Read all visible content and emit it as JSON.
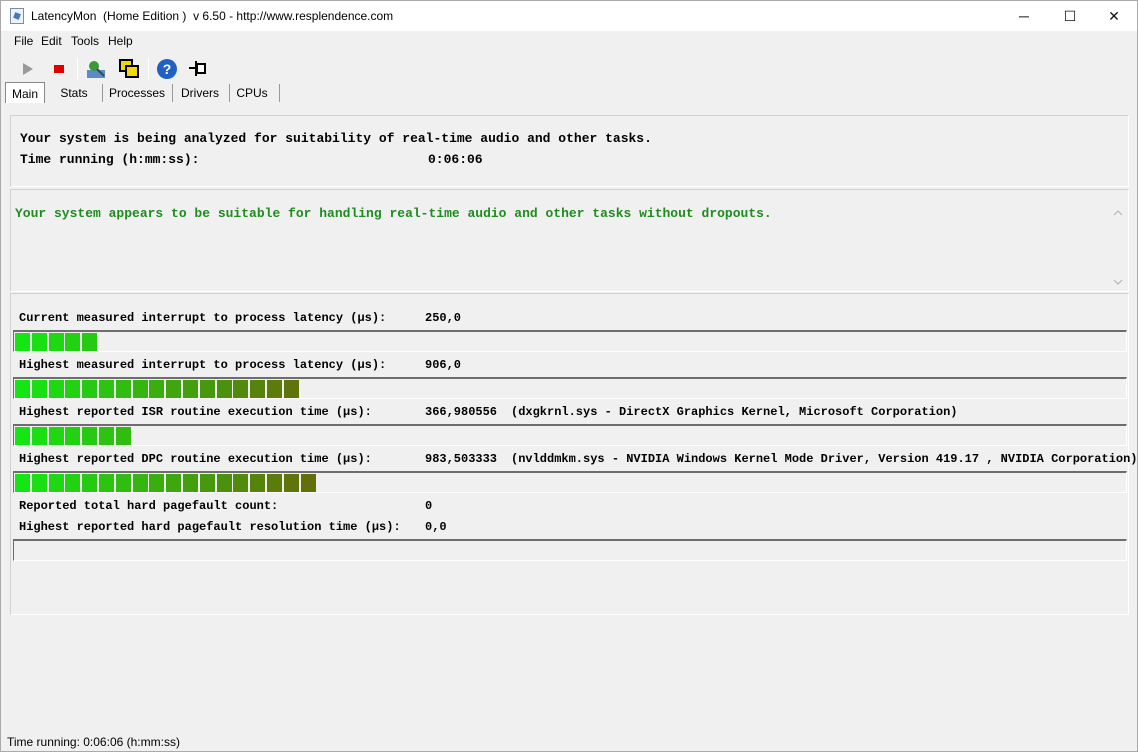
{
  "window": {
    "title": "LatencyMon  (Home Edition )  v 6.50 - http://www.resplendence.com",
    "minimize": "─",
    "maximize": "☐",
    "close": "✕"
  },
  "menu": [
    "File",
    "Edit",
    "Tools",
    "Help"
  ],
  "toolbar": {
    "icons": [
      "play-icon",
      "stop-icon",
      "analyze-icon",
      "windows-icon",
      "help-icon",
      "pin-icon"
    ],
    "colors": {
      "play": "#9a9a9a",
      "stop": "#e00000",
      "help": "#2060c0"
    }
  },
  "tabs": [
    "Main",
    "Stats",
    "Processes",
    "Drivers",
    "CPUs"
  ],
  "status_panel": {
    "line1": "Your system is being analyzed for suitability of real-time audio and other tasks.",
    "time_label": "Time running (h:mm:ss):",
    "time_value": "0:06:06"
  },
  "verdict": {
    "text": "Your system appears to be suitable for handling real-time audio and other tasks without dropouts.",
    "color": "#1e8c1e"
  },
  "metrics": [
    {
      "label": "Current measured interrupt to process latency (µs):",
      "value": "250,0",
      "detail": "",
      "bar_segments": 5
    },
    {
      "label": "Highest measured interrupt to process latency (µs):",
      "value": "906,0",
      "detail": "",
      "bar_segments": 17
    },
    {
      "label": "Highest reported ISR routine execution time (µs):",
      "value": "366,980556",
      "detail": "(dxgkrnl.sys - DirectX Graphics Kernel, Microsoft Corporation)",
      "bar_segments": 7
    },
    {
      "label": "Highest reported DPC routine execution time (µs):",
      "value": "983,503333",
      "detail": "(nvlddmkm.sys - NVIDIA Windows Kernel Mode Driver, Version 419.17 , NVIDIA Corporation)",
      "bar_segments": 18
    }
  ],
  "pagefault": {
    "count_label": "Reported total hard pagefault count:",
    "count_value": "0",
    "time_label": "Highest reported hard pagefault resolution time (µs):",
    "time_value": "0,0",
    "bar_segments": 0
  },
  "statusbar": {
    "text": "Time running: 0:06:06  (h:mm:ss)"
  }
}
